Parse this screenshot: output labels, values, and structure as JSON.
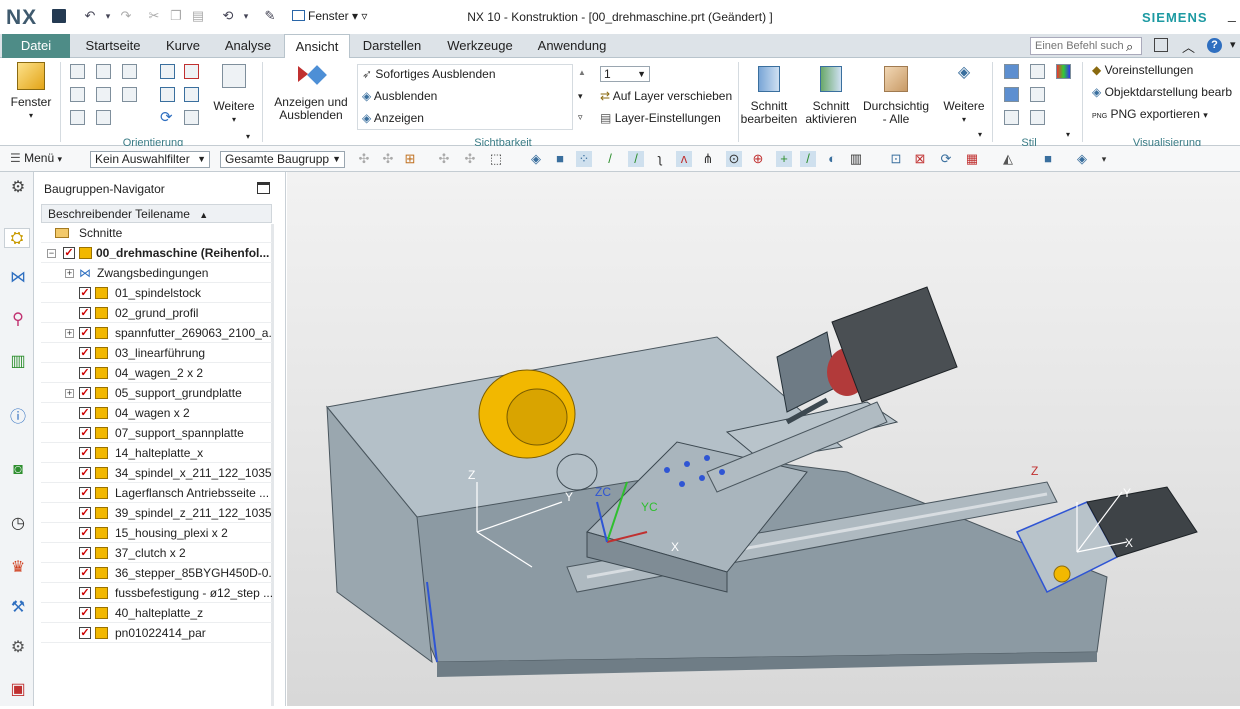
{
  "app": {
    "logo": "NX",
    "title": "NX 10 - Konstruktion - [00_drehmaschine.prt (Geändert) ]",
    "brand": "SIEMENS",
    "fenster_menu": "Fenster"
  },
  "tabs": [
    "Datei",
    "Startseite",
    "Kurve",
    "Analyse",
    "Ansicht",
    "Darstellen",
    "Werkzeuge",
    "Anwendung"
  ],
  "search": {
    "placeholder": "Einen Befehl such"
  },
  "ribbon": {
    "fenster": "Fenster",
    "weitere1": "Weitere",
    "orientierung": "Orientierung",
    "anzeigen_ausblenden_l1": "Anzeigen und",
    "anzeigen_ausblenden_l2": "Ausblenden",
    "sofortiges": "Sofortiges Ausblenden",
    "ausblenden": "Ausblenden",
    "anzeigen": "Anzeigen",
    "layer_value": "1",
    "auf_layer": "Auf Layer verschieben",
    "layer_einst": "Layer-Einstellungen",
    "sichtbarkeit": "Sichtbarkeit",
    "schnitt_bearb_l1": "Schnitt",
    "schnitt_bearb_l2": "bearbeiten",
    "schnitt_akt_l1": "Schnitt",
    "schnitt_akt_l2": "aktivieren",
    "durchsichtig_l1": "Durchsichtig",
    "durchsichtig_l2": "- Alle",
    "weitere2": "Weitere",
    "stil": "Stil",
    "voreinst": "Voreinstellungen",
    "objektdarst": "Objektdarstellung bearb",
    "png": "PNG exportieren",
    "visualisierung": "Visualisierung"
  },
  "toolbar2": {
    "menu": "Menü",
    "filter": "Kein Auswahlfilter",
    "scope": "Gesamte Baugrupp"
  },
  "navigator": {
    "title": "Baugruppen-Navigator",
    "column": "Beschreibender Teilename",
    "rows": [
      {
        "label": "Schnitte"
      },
      {
        "label": "00_drehmaschine (Reihenfol..."
      },
      {
        "label": "Zwangsbedingungen"
      },
      {
        "label": "01_spindelstock"
      },
      {
        "label": "02_grund_profil"
      },
      {
        "label": "spannfutter_269063_2100_a..."
      },
      {
        "label": "03_linearführung"
      },
      {
        "label": "04_wagen_2 x 2"
      },
      {
        "label": "05_support_grundplatte"
      },
      {
        "label": "04_wagen x 2"
      },
      {
        "label": "07_support_spannplatte"
      },
      {
        "label": "14_halteplatte_x"
      },
      {
        "label": "34_spindel_x_211_122_1035"
      },
      {
        "label": "Lagerflansch Antriebsseite ..."
      },
      {
        "label": "39_spindel_z_211_122_1035"
      },
      {
        "label": "15_housing_plexi x 2"
      },
      {
        "label": "37_clutch x 2"
      },
      {
        "label": "36_stepper_85BYGH450D-0..."
      },
      {
        "label": "fussbefestigung - ø12_step ..."
      },
      {
        "label": "40_halteplatte_z"
      },
      {
        "label": "pn01022414_par"
      }
    ]
  },
  "viewport": {
    "axis_labels": [
      "Z",
      "Y",
      "ZC",
      "YC",
      "X",
      "Z",
      "Y",
      "X"
    ]
  },
  "colors": {
    "accent": "#4e8c87",
    "brand": "#1d9aa2",
    "group": "#3a7c86",
    "chuck": "#f2b800"
  }
}
